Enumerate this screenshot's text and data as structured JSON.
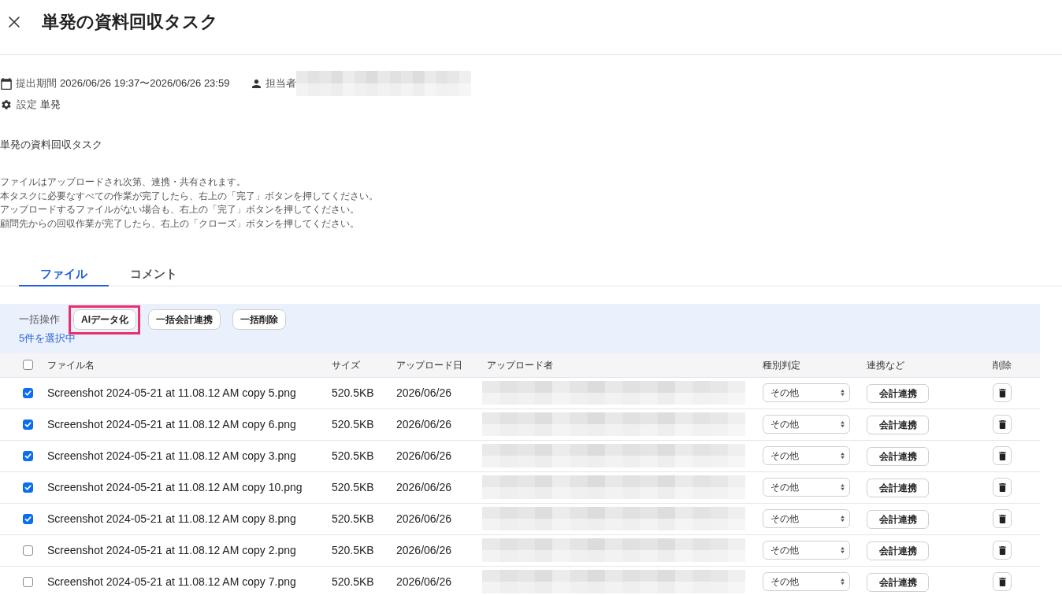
{
  "header": {
    "title": "単発の資料回収タスク"
  },
  "meta": {
    "period": {
      "label": "提出期間",
      "value": "2026/06/26 19:37〜2026/06/26 23:59"
    },
    "assignee": {
      "label": "担当者"
    },
    "setting": {
      "label": "設定",
      "value": "単発"
    }
  },
  "description": "単発の資料回収タスク",
  "notes": [
    "ファイルはアップロードされ次第、連携・共有されます。",
    "本タスクに必要なすべての作業が完了したら、右上の「完了」ボタンを押してください。",
    "アップロードするファイルがない場合も、右上の「完了」ボタンを押してください。",
    "顧問先からの回収作業が完了したら、右上の「クローズ」ボタンを押してください。"
  ],
  "tabs": [
    {
      "label": "ファイル",
      "selected": true
    },
    {
      "label": "コメント",
      "selected": false
    }
  ],
  "bulk_actions": {
    "label": "一括操作",
    "buttons": [
      {
        "label": "AIデータ化",
        "highlighted": true
      },
      {
        "label": "一括会計連携",
        "highlighted": false
      },
      {
        "label": "一括削除",
        "highlighted": false
      }
    ],
    "selection_count": "5件を選択中"
  },
  "table": {
    "select_all": {
      "checked": false
    },
    "columns": [
      "ファイル名",
      "サイズ",
      "アップロード日",
      "アップロード者",
      "種別判定",
      "連携など",
      "削除"
    ],
    "rows": [
      {
        "checked": true,
        "file_name": "Screenshot 2024-05-21 at 11.08.12 AM copy 5.png",
        "size": "520.5KB",
        "upload_date": "2026/06/26",
        "kind": "その他",
        "action": "会計連携"
      },
      {
        "checked": true,
        "file_name": "Screenshot 2024-05-21 at 11.08.12 AM copy 6.png",
        "size": "520.5KB",
        "upload_date": "2026/06/26",
        "kind": "その他",
        "action": "会計連携"
      },
      {
        "checked": true,
        "file_name": "Screenshot 2024-05-21 at 11.08.12 AM copy 3.png",
        "size": "520.5KB",
        "upload_date": "2026/06/26",
        "kind": "その他",
        "action": "会計連携"
      },
      {
        "checked": true,
        "file_name": "Screenshot 2024-05-21 at 11.08.12 AM copy 10.png",
        "size": "520.5KB",
        "upload_date": "2026/06/26",
        "kind": "その他",
        "action": "会計連携"
      },
      {
        "checked": true,
        "file_name": "Screenshot 2024-05-21 at 11.08.12 AM copy 8.png",
        "size": "520.5KB",
        "upload_date": "2026/06/26",
        "kind": "その他",
        "action": "会計連携"
      },
      {
        "checked": false,
        "file_name": "Screenshot 2024-05-21 at 11.08.12 AM copy 2.png",
        "size": "520.5KB",
        "upload_date": "2026/06/26",
        "kind": "その他",
        "action": "会計連携"
      },
      {
        "checked": false,
        "file_name": "Screenshot 2024-05-21 at 11.08.12 AM copy 7.png",
        "size": "520.5KB",
        "upload_date": "2026/06/26",
        "kind": "その他",
        "action": "会計連携"
      }
    ]
  }
}
